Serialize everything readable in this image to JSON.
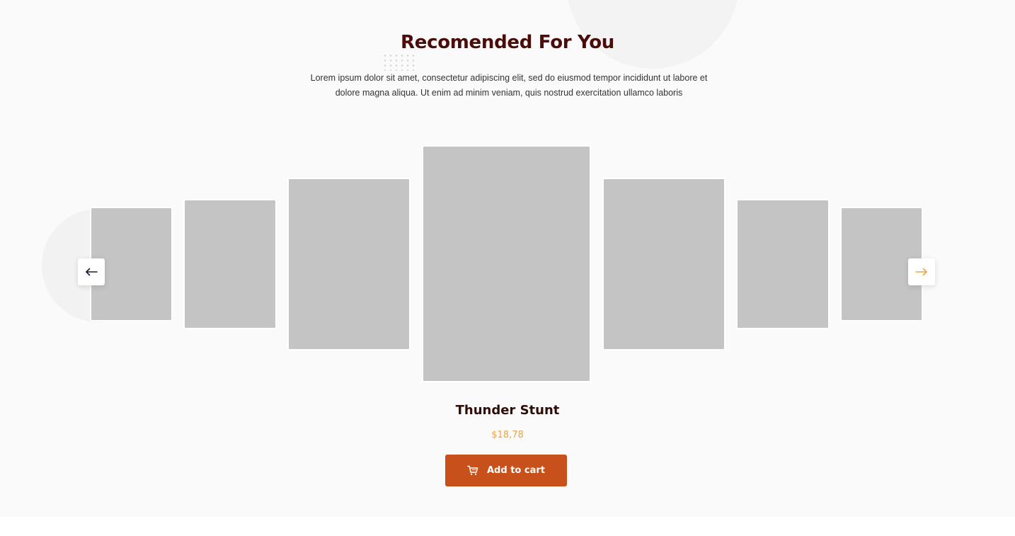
{
  "section": {
    "title": "Recomended For You",
    "subtitle": "Lorem ipsum dolor sit amet, consectetur adipiscing elit, sed do eiusmod tempor incididunt ut labore et dolore magna aliqua. Ut enim ad minim veniam, quis nostrud exercitation ullamco laboris"
  },
  "carousel": {
    "prev_icon": "arrow-left-icon",
    "next_icon": "arrow-right-icon",
    "item_count": 7,
    "active_index": 3
  },
  "product": {
    "name": "Thunder Stunt",
    "price": "$18,78",
    "cta_label": "Add to cart",
    "cta_icon": "cart-icon"
  },
  "colors": {
    "title": "#4a0d0a",
    "price": "#e8a54a",
    "accent": "#c8511b",
    "next_arrow": "#e8a54a",
    "prev_arrow": "#1a1a2e",
    "placeholder": "#c4c4c4"
  }
}
